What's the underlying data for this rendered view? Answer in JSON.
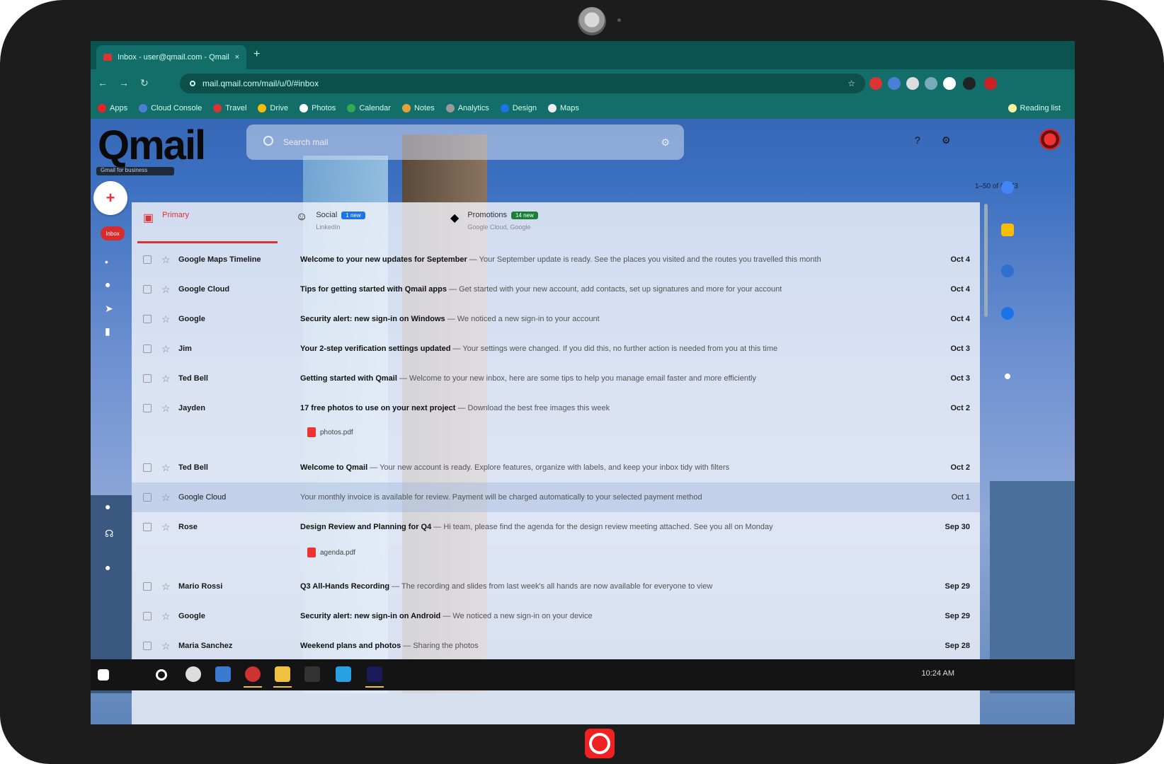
{
  "browser": {
    "tab_title": "Inbox - user@qmail.com - Qmail",
    "tab_close": "×",
    "new_tab": "+",
    "url": "mail.qmail.com/mail/u/0/#inbox",
    "nav": {
      "back": "←",
      "forward": "→",
      "reload": "↻"
    },
    "bookmarks": [
      "Apps",
      "Cloud Console",
      "Travel",
      "Drive",
      "Photos",
      "Calendar",
      "Notes",
      "Analytics",
      "Design",
      "Maps",
      "Reading list"
    ]
  },
  "app": {
    "logo": "Qmail",
    "logo_sub": "Gmail for business",
    "search_placeholder": "Search mail",
    "pagination": "1–50 of 6,873",
    "compose_icon": "+",
    "inbox_label": "Inbox"
  },
  "categories": [
    {
      "label": "Primary",
      "sub": "",
      "icon": "inbox-icon",
      "badge": ""
    },
    {
      "label": "Social",
      "sub": "LinkedIn",
      "icon": "people-icon",
      "badge": "1 new",
      "badge_color": "#1a73e8"
    },
    {
      "label": "Promotions",
      "sub": "Google Cloud, Google",
      "icon": "tag-icon",
      "badge": "14 new",
      "badge_color": "#188038"
    }
  ],
  "emails": [
    {
      "sender": "Google Maps Timeline",
      "subject": "Welcome to your new updates for September",
      "snippet": " — Your September update is ready. See the places you visited and the routes you travelled this month",
      "date": "Oct 4"
    },
    {
      "sender": "Google Cloud",
      "subject": "Tips for getting started with Qmail apps",
      "snippet": " — Get started with your new account, add contacts, set up signatures and more for your account",
      "date": "Oct 4"
    },
    {
      "sender": "Google",
      "subject": "Security alert: new sign-in on Windows",
      "snippet": " — We noticed a new sign-in to your account",
      "date": "Oct 4"
    },
    {
      "sender": "Jim",
      "subject": "Your 2-step verification settings updated",
      "snippet": " — Your settings were changed. If you did this, no further action is needed from you at this time",
      "date": "Oct 3"
    },
    {
      "sender": "Ted Bell",
      "subject": "Getting started with Qmail",
      "snippet": " — Welcome to your new inbox, here are some tips to help you manage email faster and more efficiently",
      "date": "Oct 3"
    },
    {
      "sender": "Jayden",
      "subject": "17 free photos to use on your next project",
      "snippet": " — Download the best free images this week",
      "date": "Oct 2",
      "attachment": "photos.pdf"
    },
    {
      "sender": "Ted Bell",
      "subject": "Welcome to Qmail",
      "snippet": " — Your new account is ready. Explore features, organize with labels, and keep your inbox tidy with filters",
      "date": "Oct 2"
    },
    {
      "sender": "Google Cloud",
      "subject": "",
      "snippet": "Your monthly invoice is available for review. Payment will be charged automatically to your selected payment method",
      "date": "Oct 1"
    },
    {
      "sender": "Rose",
      "subject": "Design Review and Planning for Q4",
      "snippet": " — Hi team, please find the agenda for the design review meeting attached. See you all on Monday",
      "date": "Sep 30",
      "attachment": "agenda.pdf"
    },
    {
      "sender": "Mario Rossi",
      "subject": "Q3 All-Hands Recording",
      "snippet": " — The recording and slides from last week's all hands are now available for everyone to view",
      "date": "Sep 29"
    },
    {
      "sender": "Google",
      "subject": "Security alert: new sign-in on Android",
      "snippet": " — We noticed a new sign-in on your device",
      "date": "Sep 29"
    },
    {
      "sender": "Maria Sanchez",
      "subject": "Weekend plans and photos",
      "snippet": " — Sharing the photos",
      "date": "Sep 28"
    }
  ],
  "taskbar": {
    "tray": "10:24 AM"
  }
}
